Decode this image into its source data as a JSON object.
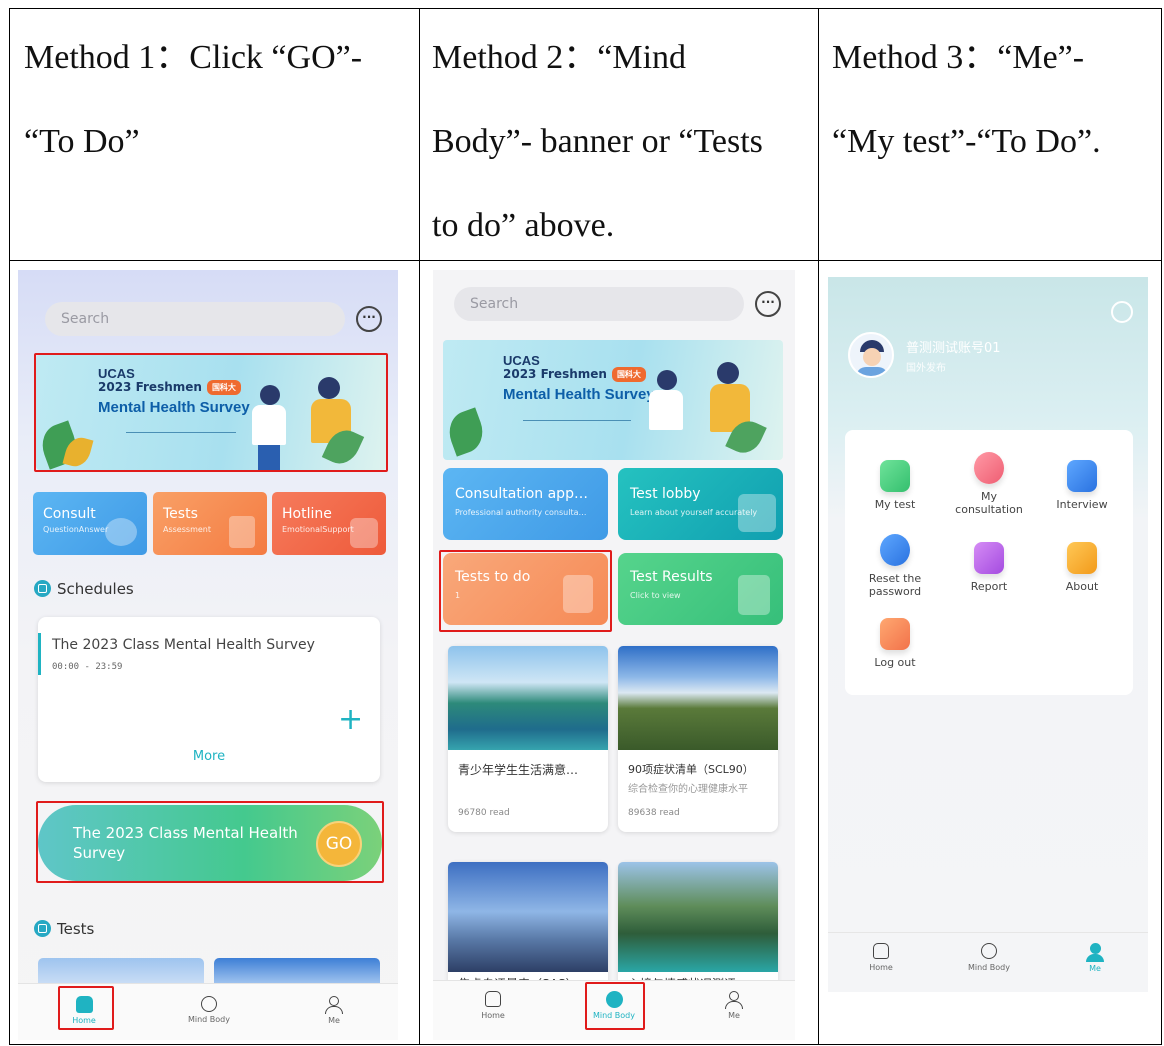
{
  "methods": [
    {
      "lines": [
        "Method 1：Click “GO”-",
        "“To Do”"
      ]
    },
    {
      "lines": [
        "Method 2：“Mind",
        "Body”- banner or “Tests",
        "to do”  above."
      ]
    },
    {
      "lines": [
        "Method 3：“Me”-",
        "“My test”-“To Do”."
      ]
    }
  ],
  "home": {
    "search_placeholder": "Search",
    "banner": {
      "org": "UCAS",
      "year": "2023 Freshmen",
      "pill": "国科大",
      "title": "Mental Health Survey"
    },
    "tiles": [
      {
        "title": "Consult",
        "sub": "QuestionAnswer",
        "color": "#4aa6ee"
      },
      {
        "title": "Tests",
        "sub": "Assessment",
        "color": "#f7894e"
      },
      {
        "title": "Hotline",
        "sub": "EmotionalSupport",
        "color": "#f0603f"
      }
    ],
    "schedules_title": "Schedules",
    "schedule_event": "The 2023 Class Mental Health Survey",
    "schedule_time": "00:00 - 23:59",
    "more": "More",
    "go_banner": "The 2023 Class Mental Health Survey",
    "go": "GO",
    "tests_title": "Tests"
  },
  "mindbody": {
    "search_placeholder": "Search",
    "tiles": [
      {
        "title": "Consultation app…",
        "sub": "Professional authority consulta…",
        "color": "#4aa6ee"
      },
      {
        "title": "Test lobby",
        "sub": "Learn about yourself accurately",
        "color": "#18b7b7"
      },
      {
        "title": "Tests to do",
        "sub": "1",
        "color": "#f7925e"
      },
      {
        "title": "Test Results",
        "sub": "Click to view",
        "color": "#3ec78a"
      }
    ],
    "articles": [
      {
        "title": "青少年学生生活满意…",
        "desc": "",
        "reads": "96780 read"
      },
      {
        "title": "90项症状清单（SCL90）",
        "desc": "综合检查你的心理健康水平",
        "reads": "89638 read"
      }
    ],
    "partial_titles": [
      "焦虑自评量表（SAS）",
      "心境与情感状况测评"
    ]
  },
  "me": {
    "username": "普测测试账号01",
    "subtitle": "国外发布",
    "items": [
      {
        "label": "My test",
        "icon": "document-icon",
        "color": "#45c873"
      },
      {
        "label": "My consultation",
        "icon": "chat-icon",
        "color": "#f26d7d"
      },
      {
        "label": "Interview",
        "icon": "video-icon",
        "color": "#2f7fe0"
      },
      {
        "label": "Reset the password",
        "icon": "key-icon",
        "color": "#2f7fe0"
      },
      {
        "label": "Report",
        "icon": "report-icon",
        "color": "#b15ce8"
      },
      {
        "label": "About",
        "icon": "person-icon",
        "color": "#f5a524"
      },
      {
        "label": "Log out",
        "icon": "logout-icon",
        "color": "#f5834a"
      }
    ]
  },
  "nav": {
    "home": "Home",
    "mind": "Mind Body",
    "me": "Me"
  },
  "colors": {
    "accent": "#1fb3c2",
    "highlight": "#e01b1b"
  }
}
